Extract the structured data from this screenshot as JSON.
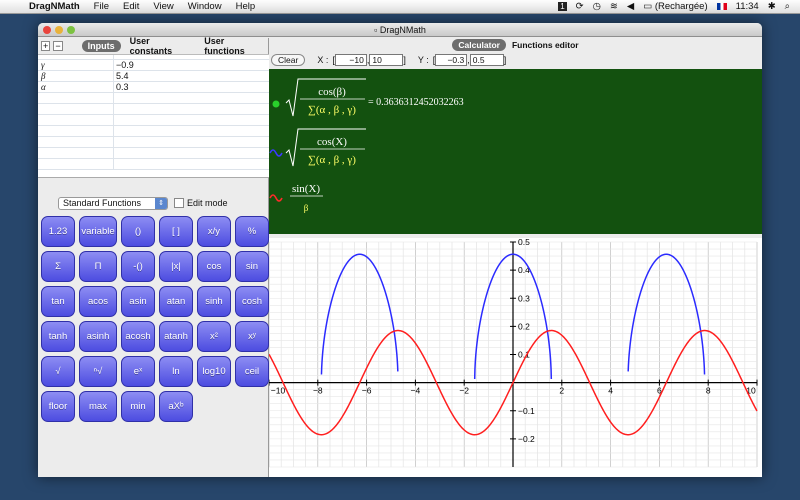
{
  "menubar": {
    "app": "DragNMath",
    "items": [
      "File",
      "Edit",
      "View",
      "Window",
      "Help"
    ],
    "battery": "(Rechargée)",
    "time": "11:34"
  },
  "window": {
    "title": "DragNMath"
  },
  "left": {
    "tabs": [
      "Inputs",
      "User constants",
      "User functions"
    ],
    "add": "+",
    "remove": "−",
    "variables": [
      {
        "name": "γ",
        "value": "−0.9"
      },
      {
        "name": "β",
        "value": "5.4"
      },
      {
        "name": "α",
        "value": "0.3"
      }
    ],
    "select": "Standard Functions",
    "edit_mode": "Edit mode",
    "keys": [
      "1.23",
      "variable",
      "()",
      "[ ]",
      "x/y",
      "%",
      "Σ",
      "Π",
      "-()",
      "|x|",
      "cos",
      "sin",
      "tan",
      "acos",
      "asin",
      "atan",
      "sinh",
      "cosh",
      "tanh",
      "asinh",
      "acosh",
      "atanh",
      "x²",
      "xʸ",
      "√",
      "ⁿ√",
      "eˣ",
      "ln",
      "log10",
      "ceil",
      "floor",
      "max",
      "min",
      "aXᵇ"
    ]
  },
  "right": {
    "tabs": [
      "Calculator",
      "Functions editor"
    ],
    "clear": "Clear",
    "x_label": "X :",
    "y_label": "Y :",
    "xmin": "−10",
    "xmax": "10",
    "ymin": "−0.3",
    "ymax": "0.5",
    "formulas": {
      "f1_num": "cos(β)",
      "f1_den": "∑(α , β , γ)",
      "f1_result": "= 0.3636312452032263",
      "f2_num": "cos(X)",
      "f2_den": "∑(α , β , γ)",
      "f3_num": "sin(X)",
      "f3_den": "β"
    }
  },
  "chart_data": {
    "type": "line",
    "xlim": [
      -10,
      10
    ],
    "ylim": [
      -0.3,
      0.5
    ],
    "grid": true,
    "xticks": [
      -10,
      -8,
      -6,
      -4,
      -2,
      0,
      2,
      4,
      6,
      8,
      10
    ],
    "yticks": [
      -0.2,
      -0.1,
      0.1,
      0.2,
      0.3,
      0.4,
      0.5
    ],
    "series": [
      {
        "formula": "sqrt(cos(X)/∑(α,β,γ))",
        "color": "#2b2bff"
      },
      {
        "formula": "sin(X)/β",
        "color": "#ff1f1f"
      }
    ],
    "params": {
      "alpha": 0.3,
      "beta": 5.4,
      "gamma": -0.9
    }
  }
}
